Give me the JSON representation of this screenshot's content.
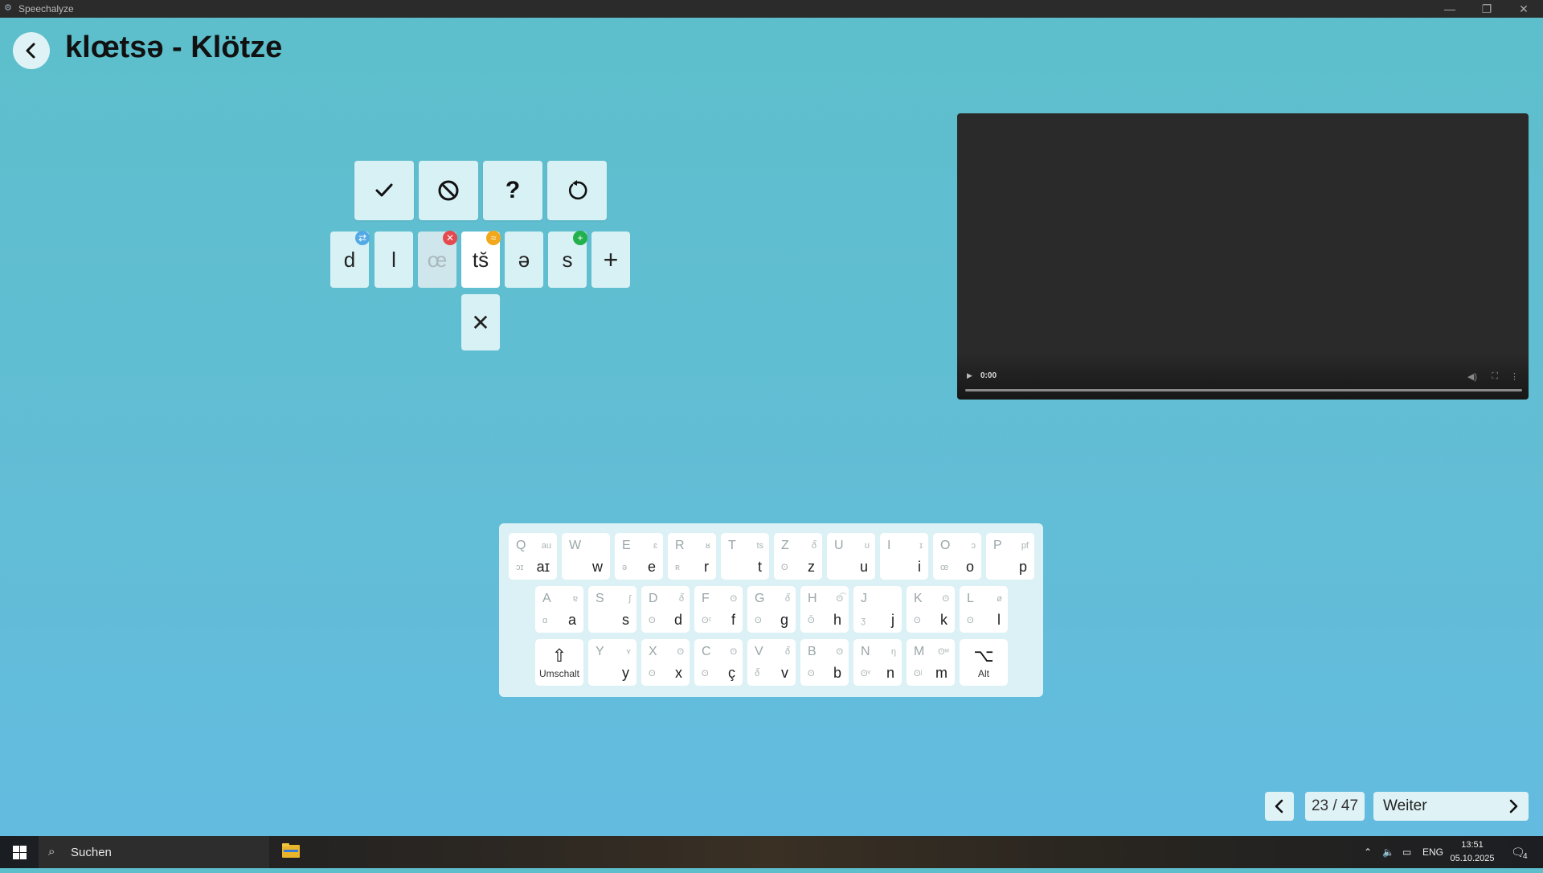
{
  "window": {
    "app_title": "Speechalyze",
    "minimize_glyph": "—",
    "restore_glyph": "❐",
    "close_glyph": "✕"
  },
  "header": {
    "title": "klœtsə - Klötze",
    "back_icon": "chevron-left-icon"
  },
  "actions": [
    {
      "name": "confirm-button",
      "glyph": "✓",
      "icon": "check-icon"
    },
    {
      "name": "reject-button",
      "glyph": "⃠",
      "icon": "ban-icon"
    },
    {
      "name": "unsure-button",
      "glyph": "?",
      "icon": "question-icon"
    },
    {
      "name": "reset-button",
      "glyph": "↻",
      "icon": "undo-icon"
    }
  ],
  "phonemes": [
    {
      "symbol": "d",
      "state": "substituted",
      "badge_icon": "swap-icon",
      "badge_color": "#52a9e6"
    },
    {
      "symbol": "l",
      "state": "normal"
    },
    {
      "symbol": "œ",
      "state": "deleted",
      "badge_icon": "delete-icon",
      "badge_color": "#e5484d"
    },
    {
      "symbol": "ts̆",
      "state": "selected",
      "badge_icon": "distortion-icon",
      "badge_color": "#f2a81d"
    },
    {
      "symbol": "ə",
      "state": "normal"
    },
    {
      "symbol": "s",
      "state": "added",
      "badge_icon": "plus-icon",
      "badge_color": "#22b14c"
    }
  ],
  "add_phoneme_glyph": "+",
  "remove_phoneme_glyph": "✕",
  "video": {
    "time": "0:00"
  },
  "keyboard": {
    "rows": [
      [
        {
          "tl": "Q",
          "tr": "au",
          "bl": "ɔɪ",
          "br": "aɪ"
        },
        {
          "tl": "W",
          "tr": "",
          "bl": "",
          "br": "w"
        },
        {
          "tl": "E",
          "tr": "ɛ",
          "bl": "ə",
          "br": "e"
        },
        {
          "tl": "R",
          "tr": "ʁ",
          "bl": "ʀ",
          "br": "r"
        },
        {
          "tl": "T",
          "tr": "ts",
          "bl": "",
          "br": "t"
        },
        {
          "tl": "Z",
          "tr": "ð̃",
          "bl": "ʘ",
          "br": "z"
        },
        {
          "tl": "U",
          "tr": "ʊ",
          "bl": "",
          "br": "u"
        },
        {
          "tl": "I",
          "tr": "ɪ",
          "bl": "",
          "br": "i"
        },
        {
          "tl": "O",
          "tr": "ɔ",
          "bl": "œ",
          "br": "o"
        },
        {
          "tl": "P",
          "tr": "pf",
          "bl": "",
          "br": "p"
        }
      ],
      [
        {
          "tl": "A",
          "tr": "ɐ",
          "bl": "ɑ",
          "br": "a"
        },
        {
          "tl": "S",
          "tr": "ʃ",
          "bl": "",
          "br": "s"
        },
        {
          "tl": "D",
          "tr": "ð̃",
          "bl": "ʘ",
          "br": "d"
        },
        {
          "tl": "F",
          "tr": "ʘ",
          "bl": "ʘᶜ",
          "br": "f"
        },
        {
          "tl": "G",
          "tr": "ð̃",
          "bl": "ʘ",
          "br": "g"
        },
        {
          "tl": "H",
          "tr": "ʘ͡",
          "bl": "ʘ̌",
          "br": "h"
        },
        {
          "tl": "J",
          "tr": "",
          "bl": "ʒ",
          "br": "j"
        },
        {
          "tl": "K",
          "tr": "ʘ",
          "bl": "ʘ",
          "br": "k"
        },
        {
          "tl": "L",
          "tr": "ø",
          "bl": "ʘ",
          "br": "l"
        }
      ],
      [
        {
          "special": true,
          "sym": "⇧",
          "label": "Umschalt"
        },
        {
          "tl": "Y",
          "tr": "ʏ",
          "bl": "",
          "br": "y"
        },
        {
          "tl": "X",
          "tr": "ʘ",
          "bl": "ʘ",
          "br": "x"
        },
        {
          "tl": "C",
          "tr": "ʘ",
          "bl": "ʘ",
          "br": "ç"
        },
        {
          "tl": "V",
          "tr": "ð̃",
          "bl": "ð̃",
          "br": "v"
        },
        {
          "tl": "B",
          "tr": "ʘ",
          "bl": "ʘ",
          "br": "b"
        },
        {
          "tl": "N",
          "tr": "ŋ",
          "bl": "ʘᵛ",
          "br": "n"
        },
        {
          "tl": "M",
          "tr": "ʘʷ",
          "bl": "ʘʲ",
          "br": "m"
        },
        {
          "special": true,
          "sym": "⌥",
          "label": "Alt"
        }
      ]
    ]
  },
  "pagination": {
    "counter": "23 / 47",
    "next_label": "Weiter"
  },
  "taskbar": {
    "search_placeholder": "Suchen",
    "language": "ENG",
    "time": "13:51",
    "date": "05.10.2025",
    "notifications": "4"
  }
}
